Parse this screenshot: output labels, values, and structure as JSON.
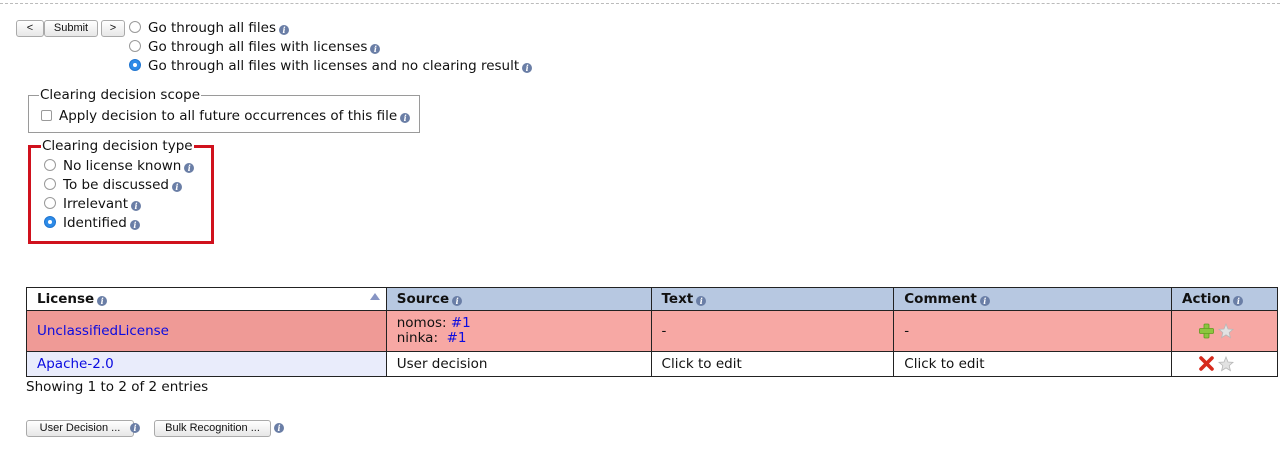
{
  "nav": {
    "prev_label": "<",
    "submit_label": "Submit",
    "next_label": ">"
  },
  "navigation_options": [
    {
      "label": "Go through all files",
      "selected": false
    },
    {
      "label": "Go through all files with licenses",
      "selected": false
    },
    {
      "label": "Go through all files with licenses and no clearing result",
      "selected": true
    }
  ],
  "scope": {
    "legend": "Clearing decision scope",
    "checkbox_label": "Apply decision to all future occurrences of this file",
    "checked": false
  },
  "decision_type": {
    "legend": "Clearing decision type",
    "options": [
      {
        "label": "No license known",
        "selected": false
      },
      {
        "label": "To be discussed",
        "selected": false
      },
      {
        "label": "Irrelevant",
        "selected": false
      },
      {
        "label": "Identified",
        "selected": true
      }
    ]
  },
  "table": {
    "headers": [
      "License",
      "Source",
      "Text",
      "Comment",
      "Action"
    ],
    "rows": [
      {
        "license": "UnclassifiedLicense",
        "source_lines": [
          {
            "agent": "nomos:",
            "link": "#1"
          },
          {
            "agent": "ninka:",
            "link": "#1"
          }
        ],
        "text": "-",
        "comment": "-",
        "actions": [
          "add-icon",
          "star-icon"
        ]
      },
      {
        "license": "Apache-2.0",
        "source": "User decision",
        "text": "Click to edit",
        "comment": "Click to edit",
        "actions": [
          "remove-icon",
          "star-icon"
        ]
      }
    ],
    "info": "Showing 1 to 2 of 2 entries"
  },
  "footer": {
    "user_decision_label": "User Decision ...",
    "bulk_recognition_label": "Bulk Recognition ..."
  },
  "colors": {
    "highlight_border": "#d0111d",
    "header_bg": "#b7c8e1",
    "row_conflict_bg": "#f7a8a4",
    "link": "#0b0be0"
  }
}
